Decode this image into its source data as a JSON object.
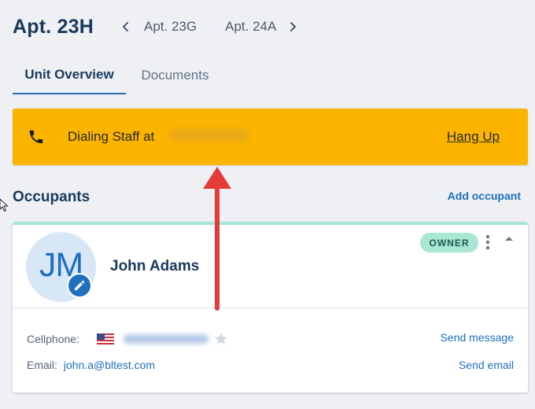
{
  "header": {
    "title": "Apt. 23H",
    "prev_unit": "Apt. 23G",
    "next_unit": "Apt. 24A"
  },
  "tabs": [
    {
      "label": "Unit Overview",
      "active": true
    },
    {
      "label": "Documents",
      "active": false
    }
  ],
  "call_banner": {
    "dialing_label": "Dialing Staff at",
    "hang_up_label": "Hang Up",
    "background": "#fbb400"
  },
  "occupants": {
    "title": "Occupants",
    "add_label": "Add occupant",
    "items": [
      {
        "initials": "JM",
        "name": "John Adams",
        "role_badge": "OWNER",
        "cellphone_label": "Cellphone:",
        "email_label": "Email:",
        "email": "john.a@bltest.com",
        "send_message_label": "Send message",
        "send_email_label": "Send email"
      }
    ]
  },
  "icons": {
    "phone": "phone-icon",
    "prev": "chevron-left-icon",
    "next": "chevron-right-icon",
    "edit": "pencil-icon",
    "more": "more-vertical-icon",
    "collapse": "chevron-up-icon",
    "flag": "us-flag-icon",
    "favorite": "star-icon"
  },
  "colors": {
    "accent": "#1f6fbf",
    "title": "#1a3a5c",
    "owner_badge": "#a9e6d3",
    "annotation_arrow": "#e53a3a"
  }
}
